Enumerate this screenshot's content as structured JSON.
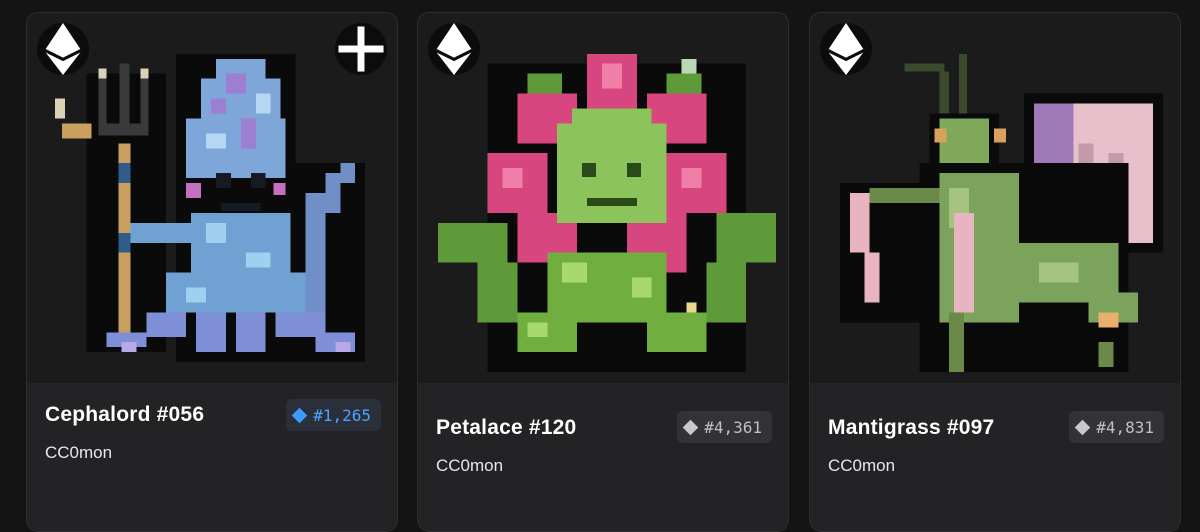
{
  "cards": [
    {
      "name": "Cephalord #056",
      "collection": "CC0mon",
      "rank": "#1,265",
      "rank_highlight": true,
      "chain_icon": "ethereum-icon",
      "has_add_button": true,
      "accent_color": "#3b9cff"
    },
    {
      "name": "Petalace #120",
      "collection": "CC0mon",
      "rank": "#4,361",
      "rank_highlight": false,
      "chain_icon": "ethereum-icon",
      "has_add_button": false
    },
    {
      "name": "Mantigrass #097",
      "collection": "CC0mon",
      "rank": "#4,831",
      "rank_highlight": false,
      "chain_icon": "ethereum-icon",
      "has_add_button": false
    }
  ]
}
